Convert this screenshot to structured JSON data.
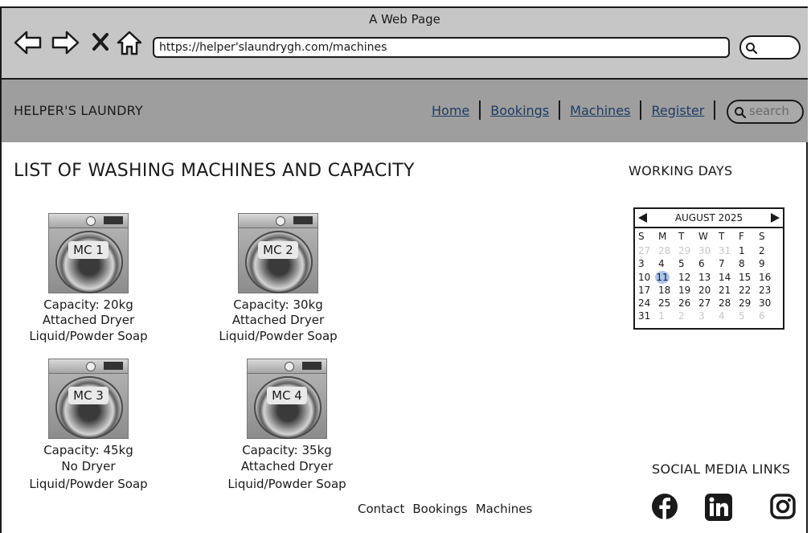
{
  "browser": {
    "window_title": "A Web Page",
    "url": "https://helper'slaundrygh.com/machines",
    "icons": [
      "back-arrow-icon",
      "forward-arrow-icon",
      "close-icon",
      "home-icon",
      "search-icon"
    ]
  },
  "header": {
    "brand": "HELPER'S LAUNDRY",
    "nav": [
      "Home",
      "Bookings",
      "Machines",
      "Register"
    ],
    "search_placeholder": "search",
    "background": "#9e9e9e",
    "link_color": "#1f3b63"
  },
  "main": {
    "title": "LIST OF WASHING MACHINES AND CAPACITY",
    "machines": [
      {
        "label": "MC 1",
        "capacity": "Capacity: 20kg",
        "dryer": "Attached Dryer",
        "soap": "Liquid/Powder Soap"
      },
      {
        "label": "MC 2",
        "capacity": "Capacity: 30kg",
        "dryer": "Attached Dryer",
        "soap": "Liquid/Powder Soap"
      },
      {
        "label": "MC 3",
        "capacity": "Capacity: 45kg",
        "dryer": "No Dryer",
        "soap": "Liquid/Powder Soap"
      },
      {
        "label": "MC 4",
        "capacity": "Capacity: 35kg",
        "dryer": "Attached Dryer",
        "soap": "Liquid/Powder Soap"
      }
    ]
  },
  "sidebar": {
    "working_days_title": "WORKING DAYS",
    "calendar": {
      "month": "AUGUST 2025",
      "weekdays": [
        "S",
        "M",
        "T",
        "W",
        "T",
        "F",
        "S"
      ],
      "days": [
        [
          "27",
          "28",
          "29",
          "30",
          "31",
          "1",
          "2"
        ],
        [
          "3",
          "4",
          "5",
          "6",
          "7",
          "8",
          "9"
        ],
        [
          "10",
          "11",
          "12",
          "13",
          "14",
          "15",
          "16"
        ],
        [
          "17",
          "18",
          "19",
          "20",
          "21",
          "22",
          "23"
        ],
        [
          "24",
          "25",
          "26",
          "27",
          "28",
          "29",
          "30"
        ],
        [
          "31",
          "1",
          "2",
          "3",
          "4",
          "5",
          "6"
        ]
      ],
      "selected": "11",
      "highlight_color": "#a9c4ef"
    },
    "social_title": "SOCIAL MEDIA LINKS",
    "social_icons": [
      "facebook-icon",
      "linkedin-icon",
      "instagram-icon"
    ]
  },
  "footer": {
    "links": [
      "Contact",
      "Bookings",
      "Machines"
    ]
  }
}
